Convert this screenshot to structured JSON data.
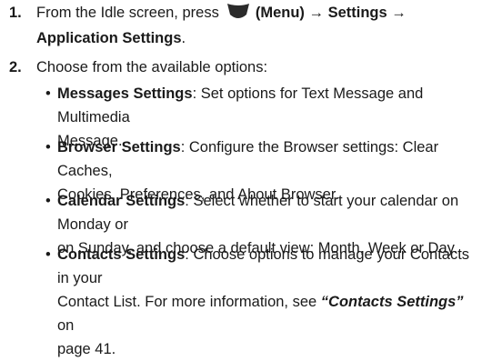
{
  "steps": [
    {
      "number": "1.",
      "pre": "From the Idle screen, press",
      "menu_label": "(Menu)",
      "arrow1": "→",
      "settings": "Settings",
      "arrow2": "→",
      "app_settings": "Application Settings",
      "end": ".",
      "menu_icon": "menu-key-icon"
    },
    {
      "number": "2.",
      "text": "Choose from the available options:"
    }
  ],
  "bullets": [
    {
      "title": "Messages Settings",
      "line1": ": Set options for Text Message and Multimedia",
      "line2": "Message."
    },
    {
      "title": "Browser Settings",
      "line1": ": Configure the Browser settings: Clear Caches,",
      "line2": "Cookies, Preferences, and About Browser."
    },
    {
      "title": "Calendar Settings",
      "line1": ": Select whether to start your calendar on Monday or",
      "line2": "on Sunday, and choose a default view: Month, Week or Day."
    },
    {
      "title": "Contacts Settings",
      "line1": ": Choose options to manage your Contacts in your",
      "line2_pre": "Contact List. For more information, see ",
      "line2_ref": "“Contacts Settings”",
      "line2_post": " on",
      "line3": "page 41."
    }
  ],
  "bullet_symbol": "•",
  "colors": {
    "text": "#1a1a1a",
    "icon": "#2b2b2b"
  }
}
